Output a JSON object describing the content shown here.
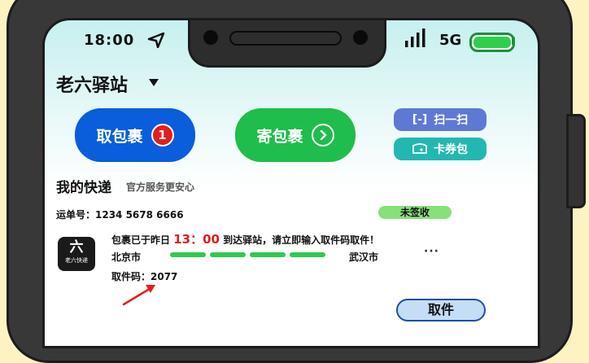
{
  "status_bar": {
    "time": "18:00",
    "network": "5G"
  },
  "header": {
    "station_name": "老六驿站"
  },
  "actions": {
    "pickup_label": "取包裹",
    "pickup_badge": "1",
    "send_label": "寄包裹",
    "scan_label": "扫一扫",
    "scan_icon": "[-]",
    "coupon_label": "卡券包"
  },
  "section": {
    "title": "我的快递",
    "subtitle": "官方服务更安心"
  },
  "parcel": {
    "waybill": "运单号：1234 5678 6666",
    "status": "未签收",
    "logo_main": "六",
    "logo_sub": "老六快递",
    "message_prefix": "包裹已于昨日",
    "message_time": "13：00",
    "message_suffix": "到达驿站，请立即输入取件码取件！",
    "from": "北京市",
    "to": "武汉市",
    "progress_segments_filled": 4,
    "progress_segments_total": 4,
    "pickup_code": "取件码：2077",
    "more": "···",
    "pickup_button": "取件"
  },
  "colors": {
    "pickup_button": "#0a5ddb",
    "send_button": "#1fbd4b",
    "scan_button": "#5e79d4",
    "coupon_button": "#22b8b2",
    "status_badge": "#88e07b",
    "highlight_time": "#e01b1b",
    "progress": "#2fc94d"
  },
  "icons": [
    "navigation-arrow-icon",
    "signal-icon",
    "battery-icon",
    "dropdown-caret-icon",
    "arrow-right-circle-icon",
    "scan-icon",
    "coupon-icon",
    "more-icon",
    "annotation-arrow-icon"
  ]
}
